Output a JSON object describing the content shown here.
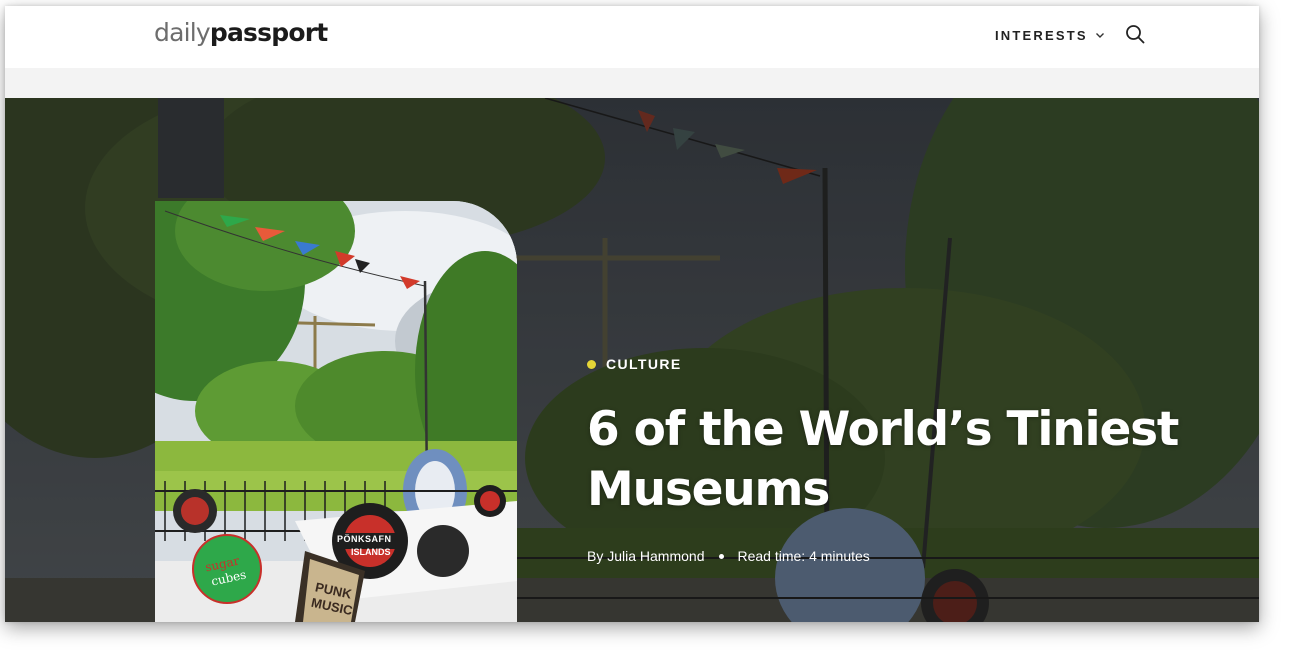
{
  "header": {
    "logo": {
      "part1": "daily",
      "part2": "passport"
    },
    "nav": {
      "interests_label": "INTERESTS",
      "interests_icon": "chevron-down-icon"
    },
    "search_icon": "search-icon"
  },
  "article": {
    "category": "CULTURE",
    "title": "6 of the World’s Tiniest Museums",
    "author": "By Julia Hammond",
    "read_time": "Read time: 4 minutes"
  },
  "thumbnail_signs": {
    "sign1": "sugar",
    "sign2": "cubes",
    "sign3": "PÖNKSAFN",
    "sign4": "ISLANDS",
    "sign5": "PUNK",
    "sign6": "MUSIC"
  },
  "colors": {
    "category_dot": "#e6d537",
    "header_bg": "#ffffff",
    "text_on_hero": "#ffffff"
  }
}
